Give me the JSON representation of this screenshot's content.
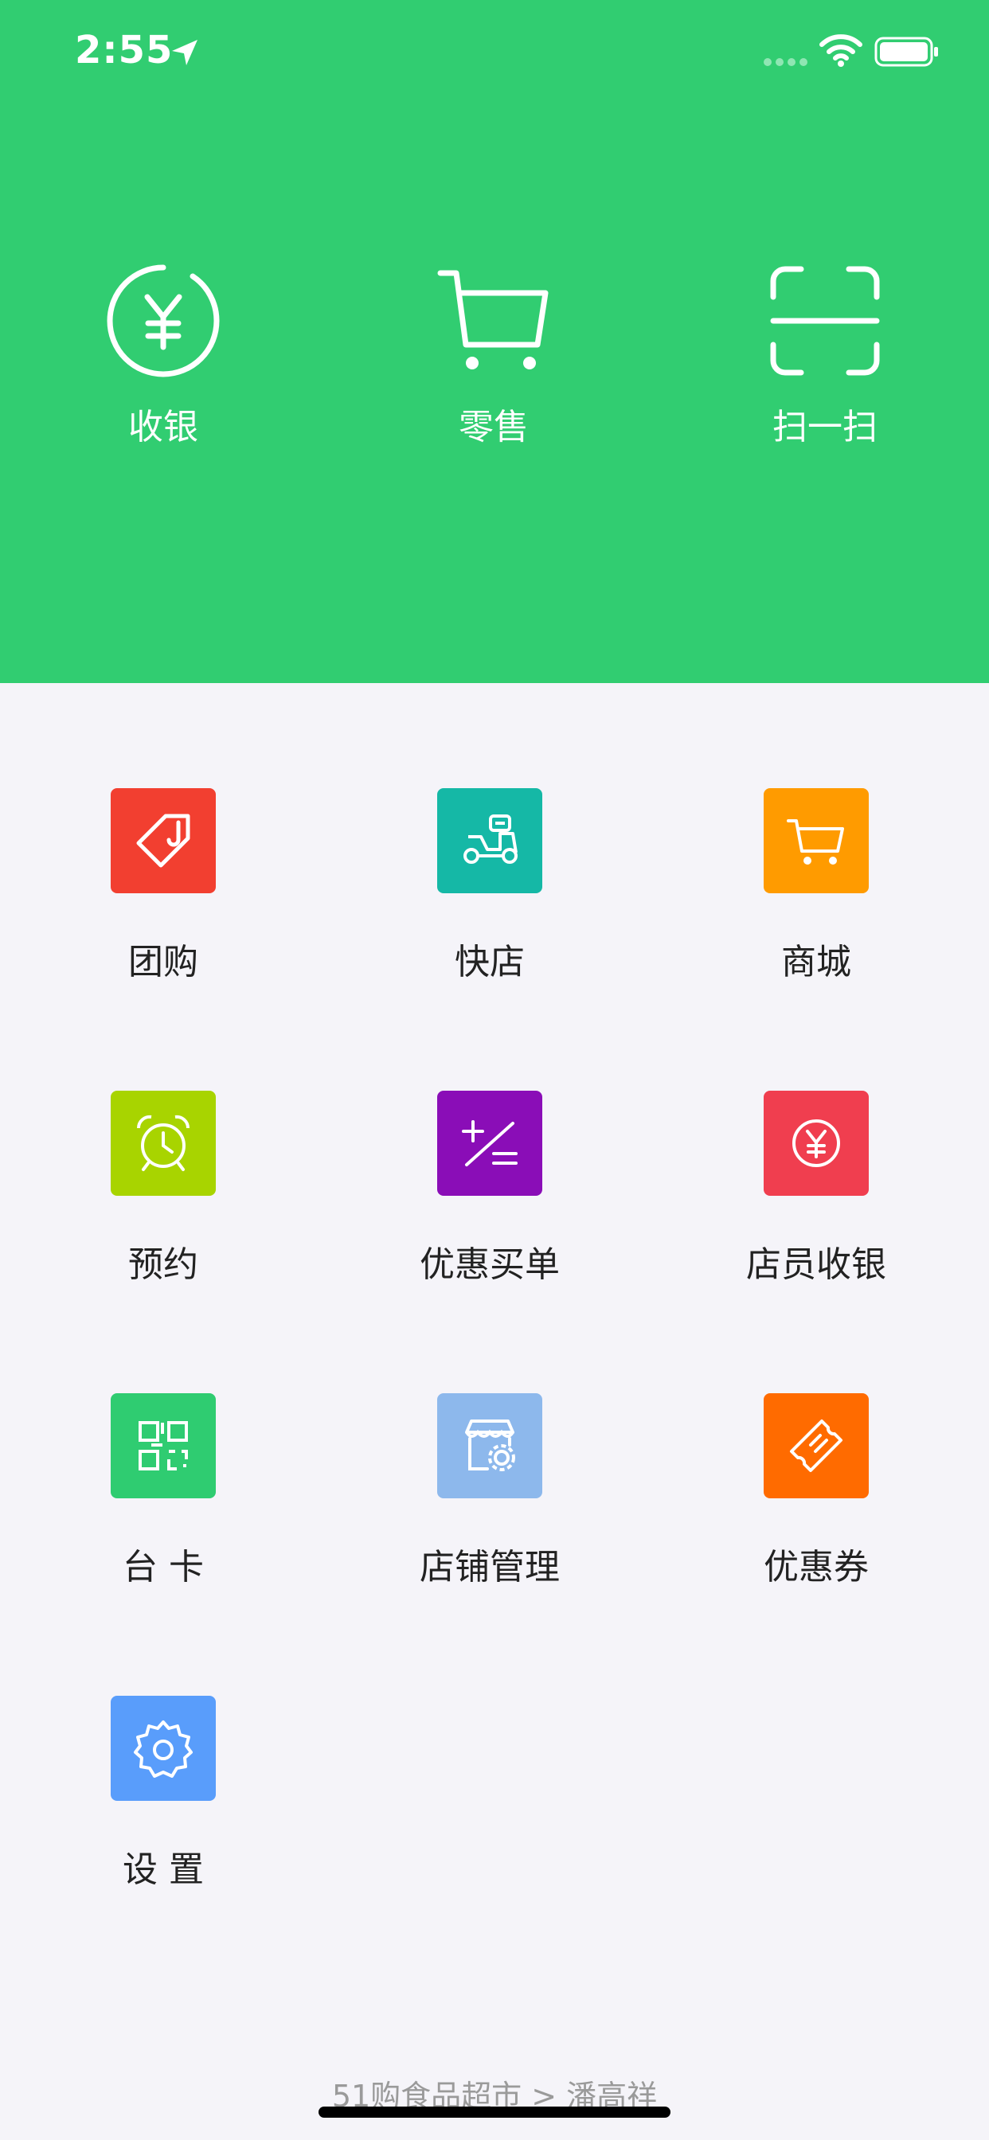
{
  "status_bar": {
    "time": "2:55"
  },
  "top_actions": [
    {
      "label": "收银",
      "icon": "yuan-circle-icon"
    },
    {
      "label": "零售",
      "icon": "cart-icon"
    },
    {
      "label": "扫一扫",
      "icon": "scan-icon"
    }
  ],
  "grid": [
    {
      "label": "团购",
      "icon": "tag-icon",
      "color": "#f23f30"
    },
    {
      "label": "快店",
      "icon": "scooter-icon",
      "color": "#15b8a6"
    },
    {
      "label": "商城",
      "icon": "cart-icon",
      "color": "#ff9b00"
    },
    {
      "label": "预约",
      "icon": "alarm-clock-icon",
      "color": "#a8d400"
    },
    {
      "label": "优惠买单",
      "icon": "discount-calc-icon",
      "color": "#8a0db7"
    },
    {
      "label": "店员收银",
      "icon": "yuan-circle-icon",
      "color": "#f03e4f"
    },
    {
      "label": "台 卡",
      "icon": "qr-code-icon",
      "color": "#2fcc71"
    },
    {
      "label": "店铺管理",
      "icon": "store-settings-icon",
      "color": "#8db8ec"
    },
    {
      "label": "优惠券",
      "icon": "ticket-icon",
      "color": "#ff6b00"
    },
    {
      "label": "设 置",
      "icon": "gear-icon",
      "color": "#599dfb"
    }
  ],
  "footer": {
    "text": "51购食品超市 > 潘高祥"
  },
  "colors": {
    "header_bg": "#31cd71",
    "page_bg": "#f5f4f9"
  }
}
